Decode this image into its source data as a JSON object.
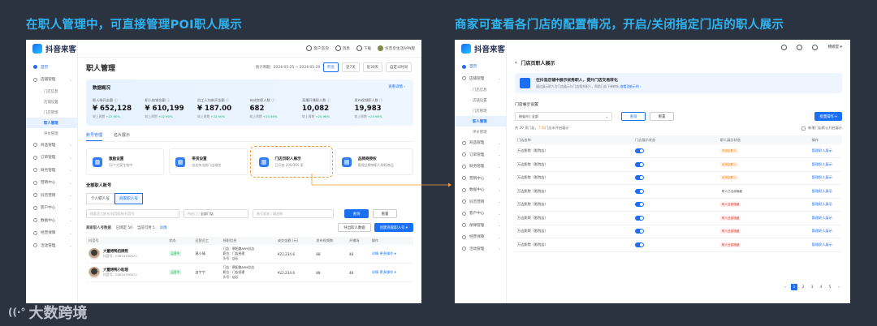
{
  "captions": {
    "left": "在职人管理中，可直接管理POI职人展示",
    "right": "商家可查看各门店的配置情况，开启/关闭指定门店的职人展示"
  },
  "watermark": "大数跨境",
  "brand": {
    "name": "抖音来客"
  },
  "left": {
    "topbar": {
      "customer": "客户咨询",
      "notice": "消息",
      "download": "下载",
      "user": "抖音亲生活APN版"
    },
    "sidebar": [
      {
        "label": "首页",
        "type": "home"
      },
      {
        "label": "店铺管理",
        "type": "group"
      },
      {
        "label": "门店信息",
        "type": "sub"
      },
      {
        "label": "店铺设置",
        "type": "sub"
      },
      {
        "label": "门店管理",
        "type": "sub"
      },
      {
        "label": "职人管理",
        "type": "sub",
        "active": true
      },
      {
        "label": "评价管理",
        "type": "sub"
      },
      {
        "label": "商品管理",
        "type": "group"
      },
      {
        "label": "订单管理",
        "type": "group"
      },
      {
        "label": "财务管理",
        "type": "group"
      },
      {
        "label": "营销中心",
        "type": "group"
      },
      {
        "label": "抖音营销",
        "type": "group"
      },
      {
        "label": "客户中心",
        "type": "group"
      },
      {
        "label": "数据中心",
        "type": "group"
      },
      {
        "label": "经营保障",
        "type": "group"
      },
      {
        "label": "活动管理",
        "type": "group"
      }
    ],
    "title": "职人管理",
    "date_range": "统计周期：2024-05-25 ~ 2024-05-29",
    "date_chips": [
      "昨天",
      "近7天",
      "近30天",
      "自定义时间"
    ],
    "overview": {
      "title": "数据概况",
      "more": "查看详情 ›",
      "stats": [
        {
          "label": "职人带开金额 ⓘ",
          "value": "¥ 652,128",
          "cmp": "较上周期",
          "delta": "+22.90%"
        },
        {
          "label": "职人核销金额 ⓘ",
          "value": "¥ 610,199",
          "cmp": "较上周期",
          "delta": "+22.90%"
        },
        {
          "label": "员工人均带开金额 ⓘ",
          "value": "¥ 187.00",
          "cmp": "较上周期",
          "delta": "+22.90%"
        },
        {
          "label": "有成交职人数 ⓘ",
          "value": "682",
          "cmp": "较上周期",
          "delta": "+20.98%"
        },
        {
          "label": "直播开播职人数 ⓘ",
          "value": "10,082",
          "cmp": "较上周期",
          "delta": "+20.98%"
        },
        {
          "label": "发布视频职人数 ⓘ",
          "value": "19,983",
          "cmp": "较上周期",
          "delta": "+20.98%"
        }
      ]
    },
    "tabs": [
      "账号管理",
      "名片展示"
    ],
    "cards": [
      {
        "title": "激励设置",
        "sub": "32个方案生效中"
      },
      {
        "title": "带货设置",
        "sub": "仅支持当前门店带货"
      },
      {
        "title": "门店页职人展示",
        "sub": "已开启 200/300 家"
      },
      {
        "title": "品牌商授权",
        "sub": "管理品牌商职人授权商品"
      }
    ],
    "section": "全部职人账号",
    "segments": [
      "个人职人号",
      "商家职人号"
    ],
    "filters": {
      "search": "搜索员工姓名/抖音昵称/抖音号",
      "store_label": "所在门",
      "store_value": "全部门店",
      "status_label": "账号状态",
      "status_value": "请选择",
      "query": "查询",
      "reset": "重置"
    },
    "listbar": {
      "label": "商家职人号数据",
      "bound": "已绑定 50",
      "current": "当前可用 5",
      "detail": "详情",
      "export": "导出职人数据",
      "create": "创建商家职人号 ▾"
    },
    "columns": [
      "抖音号",
      "状态",
      "运营员工",
      "授职信息",
      "成交金额 (元)",
      "发布视频数",
      "开播场",
      "操作"
    ],
    "rows": [
      {
        "name": "大董烤鸭招牌熊",
        "id": "抖音号：02834750872",
        "status": "运营中",
        "staff": "莫小倩",
        "info1": "门店：朝阳路APM总店",
        "info2": "职位：门店经理",
        "info3": "头号：店长",
        "amount": "¥22,234.6",
        "videos": "88",
        "live": "48",
        "ops": "详情  更多操作 ▾"
      },
      {
        "name": "大董烤鸭小助理",
        "id": "抖音号：02834750872",
        "status": "运营中",
        "staff": "白宁宁",
        "info1": "门店：朝阳路APM总店",
        "info2": "职位：门店经理",
        "info3": "头号：店长",
        "amount": "¥22,234.6",
        "videos": "88",
        "live": "48",
        "ops": "详情  更多操作 ▾"
      }
    ]
  },
  "right": {
    "topbar": {
      "user": "杨婉莹 ▾"
    },
    "sidebar": [
      {
        "label": "首页",
        "type": "home"
      },
      {
        "label": "店铺管理",
        "type": "group"
      },
      {
        "label": "门店信息",
        "type": "sub"
      },
      {
        "label": "店铺设置",
        "type": "sub"
      },
      {
        "label": "门店管理",
        "type": "sub"
      },
      {
        "label": "职人管理",
        "type": "sub",
        "active": true
      },
      {
        "label": "评价管理",
        "type": "sub"
      },
      {
        "label": "商品管理",
        "type": "group"
      },
      {
        "label": "订单管理",
        "type": "group"
      },
      {
        "label": "财务管理",
        "type": "group"
      },
      {
        "label": "营销中心",
        "type": "group"
      },
      {
        "label": "数据中心",
        "type": "group"
      },
      {
        "label": "抖音营销",
        "type": "group"
      },
      {
        "label": "客户中心",
        "type": "group"
      },
      {
        "label": "保障管理",
        "type": "group"
      },
      {
        "label": "经营保障",
        "type": "group"
      },
      {
        "label": "活动管理",
        "type": "group"
      }
    ],
    "title": "门店页职人展示",
    "banner": {
      "title": "在抖音店铺中展示优秀职人，提升门店交易转化",
      "sub": "通过展示职人为门店展示与门店相关职人，帮助门店下单转化",
      "link": "查看功能示例 ›"
    },
    "section": "门店展示设置",
    "filters": {
      "label": "按省市",
      "value": "全部",
      "query": "查询",
      "reset": "重置",
      "batch": "批量操作 ▾"
    },
    "meta": {
      "left": "共 20 家门店，",
      "highlight": "7 家",
      "left2": "门店未开启展示",
      "right": "新增门店默认开启展示"
    },
    "columns": [
      "门店名称",
      "门店展示状态",
      "职人展示状态",
      "操作"
    ],
    "rows": [
      {
        "store": "万达影院（影院店）",
        "status": "未绑定职人",
        "kind": "warn",
        "op": "管理职人展示"
      },
      {
        "store": "万达影院（影院店）",
        "status": "未绑定职人",
        "kind": "warn",
        "op": "管理职人展示"
      },
      {
        "store": "万达影院（影院店）",
        "status": "未绑定职人",
        "kind": "warn",
        "op": "管理职人展示"
      },
      {
        "store": "万达影院（影院店）",
        "status": "职人已全部隐藏",
        "kind": "plain",
        "op": "管理职人展示"
      },
      {
        "store": "万达影院（影院店）",
        "status": "职人全部隐藏",
        "kind": "red",
        "op": "管理职人展示"
      },
      {
        "store": "万达影院（影院店）",
        "status": "职人全部隐藏",
        "kind": "red",
        "op": "管理职人展示"
      },
      {
        "store": "万达影院（影院店）",
        "status": "职人全部隐藏",
        "kind": "red",
        "op": "管理职人展示"
      },
      {
        "store": "万达影院（影院店）",
        "status": "职人全部隐藏",
        "kind": "red",
        "op": "管理职人展示"
      }
    ],
    "pager": [
      "‹",
      "1",
      "2",
      "3",
      "4",
      "5",
      "›"
    ]
  },
  "colors": {
    "accent": "#1d6ff2",
    "caption": "#2fb4f2",
    "connector": "#f29a3b",
    "background": "#2c3340"
  }
}
